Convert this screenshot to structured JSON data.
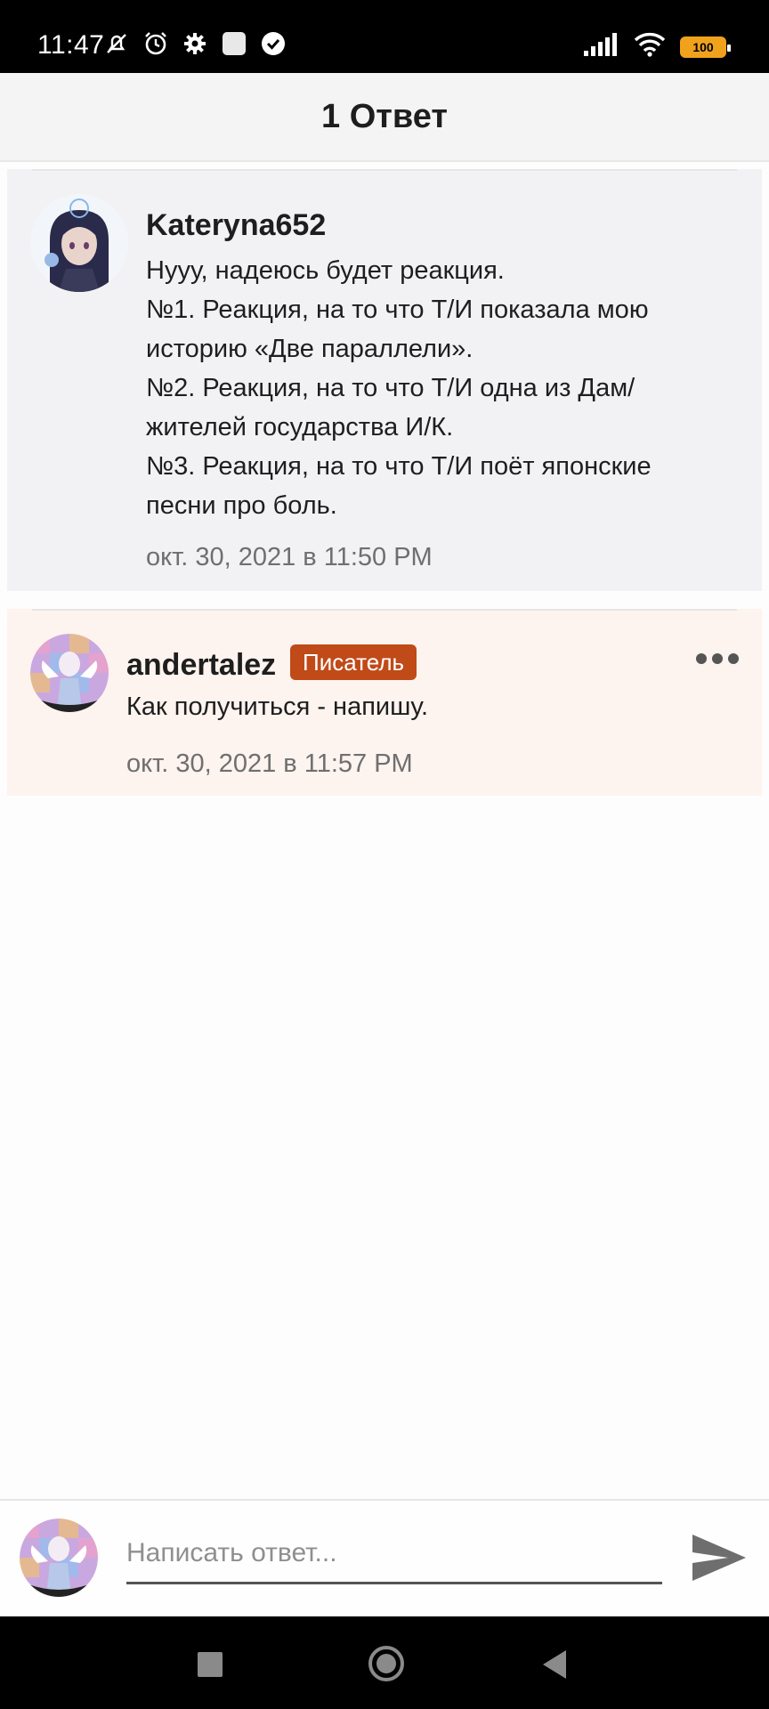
{
  "status_bar": {
    "time": "11:47",
    "battery": "100",
    "icons_left": [
      "mute-icon",
      "alarm-icon",
      "gear-icon",
      "app-square-icon",
      "check-circle-icon"
    ],
    "icons_right": [
      "signal-icon",
      "wifi-icon",
      "battery-icon"
    ]
  },
  "header": {
    "title": "1 Ответ"
  },
  "parent_comment": {
    "author": "Kateryna652",
    "lines": [
      "Нууу, надеюсь будет реакция.",
      "№1. Реакция, на то что Т/И показала мою",
      "историю «Две параллели».",
      "№2. Реакция, на то что Т/И одна из Дам/",
      "жителей государства И/К.",
      "№3. Реакция, на то что Т/И поёт японские",
      "песни про боль."
    ],
    "timestamp": "окт. 30, 2021 в 11:50 PM"
  },
  "reply_comment": {
    "author": "andertalez",
    "badge": "Писатель",
    "text": "Как получиться - напишу.",
    "timestamp": "окт. 30, 2021 в 11:57 PM"
  },
  "composer": {
    "placeholder": "Написать ответ..."
  },
  "colors": {
    "badge": "#c04a18",
    "battery": "#f1a21c",
    "reply_bg": "#fdf3ef",
    "parent_bg": "#f2f2f4"
  }
}
